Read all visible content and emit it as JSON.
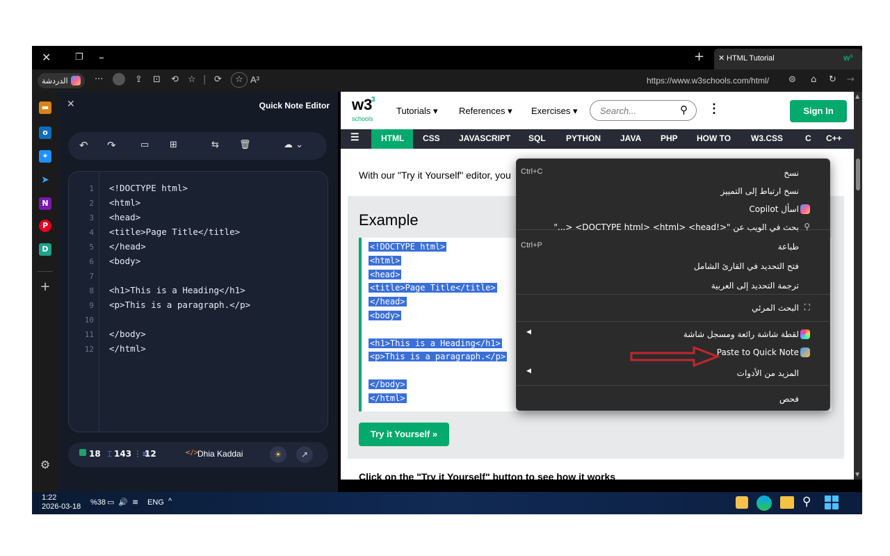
{
  "browser": {
    "tab_title": "HTML Tutorial",
    "chat_label": "الدردشة",
    "url": "https://www.w3schools.com/html/",
    "read_aloud": "A³"
  },
  "editor": {
    "title": "Quick Note Editor",
    "lines": [
      "<!DOCTYPE html>",
      "<html>",
      "<head>",
      "<title>Page Title</title>",
      "</head>",
      "<body>",
      "",
      "<h1>This is a Heading</h1>",
      "<p>This is a paragraph.</p>",
      "",
      "</body>",
      "</html>"
    ],
    "line_numbers": [
      "1",
      "2",
      "3",
      "4",
      "5",
      "6",
      "7",
      "8",
      "9",
      "10",
      "11",
      "12"
    ],
    "stats": {
      "lines": "18",
      "words": "143",
      "items": "12"
    },
    "author": "Dhia Kaddai",
    "author_tag": "</>"
  },
  "w3": {
    "logo": "w3",
    "logo_sup": "3",
    "logo_sub": "schools",
    "nav": [
      "Tutorials",
      "References",
      "Exercises"
    ],
    "search_placeholder": "Search...",
    "signin": "Sign In",
    "subnav": [
      "HTML",
      "CSS",
      "JAVASCRIPT",
      "SQL",
      "PYTHON",
      "JAVA",
      "PHP",
      "HOW TO",
      "W3.CSS",
      "C",
      "C++"
    ],
    "intro": "With our \"Try it Yourself\" editor, you",
    "example_title": "Example",
    "example_code": [
      "<!DOCTYPE html>",
      "<html>",
      "<head>",
      "<title>Page Title</title>",
      "</head>",
      "<body>",
      "",
      "<h1>This is a Heading</h1>",
      "<p>This is a paragraph.</p>",
      "",
      "</body>",
      "</html>"
    ],
    "try_button": "Try it Yourself »",
    "bottom_text": "Click on the \"Try it Yourself\" button to see how it works"
  },
  "context_menu": {
    "items": [
      {
        "label": "نسخ",
        "shortcut": "Ctrl+C"
      },
      {
        "label": "نسخ ارتباط إلى التمييز"
      },
      {
        "label": "اسأل Copilot",
        "icon": "copilot-icon"
      },
      {
        "label": "بحث في الويب عن \"<!DOCTYPE html> <html> <head> <...\"",
        "icon": "search-icon"
      },
      {
        "label": "طباعة",
        "shortcut": "Ctrl+P"
      },
      {
        "label": "فتح التحديد في القارئ الشامل"
      },
      {
        "label": "ترجمة التحديد إلى العربية"
      },
      {
        "label": "البحث المرئي",
        "icon": "visual-search-icon"
      },
      {
        "label": "لقطة شاشة رائعة ومسجل شاشة",
        "icon": "awesome-screenshot-icon",
        "submenu": true
      },
      {
        "label": "Paste to Quick Note",
        "icon": "quick-note-icon"
      },
      {
        "label": "المزيد من الأدوات",
        "submenu": true
      },
      {
        "label": "فحص"
      }
    ]
  },
  "taskbar": {
    "time": "1:22",
    "date": "2026-03-18",
    "battery": "%38",
    "language": "ENG"
  },
  "colors": {
    "accent_green": "#04AA6D",
    "selection_blue": "#3a6fd8",
    "arrow_red": "#c0272d"
  }
}
